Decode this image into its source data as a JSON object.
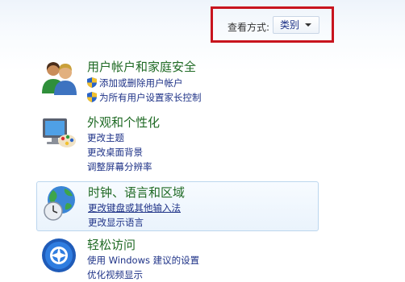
{
  "view_by": {
    "label": "查看方式:",
    "selected": "类别"
  },
  "categories": [
    {
      "title": "用户帐户和家庭安全",
      "links": [
        "添加或删除用户帐户",
        "为所有用户设置家长控制"
      ]
    },
    {
      "title": "外观和个性化",
      "links": [
        "更改主题",
        "更改桌面背景",
        "调整屏幕分辨率"
      ]
    },
    {
      "title": "时钟、语言和区域",
      "links": [
        "更改键盘或其他输入法",
        "更改显示语言"
      ]
    },
    {
      "title": "轻松访问",
      "links": [
        "使用 Windows 建议的设置",
        "优化视频显示"
      ]
    }
  ],
  "icons": {
    "user_accounts": "users-icon",
    "appearance": "monitor-palette-icon",
    "clock_language": "globe-clock-icon",
    "ease_of_access": "ease-of-access-icon",
    "shield": "uac-shield-icon"
  },
  "colors": {
    "highlight_border": "#c8141e",
    "title_green": "#1f6a24",
    "link_blue": "#1e3287"
  }
}
